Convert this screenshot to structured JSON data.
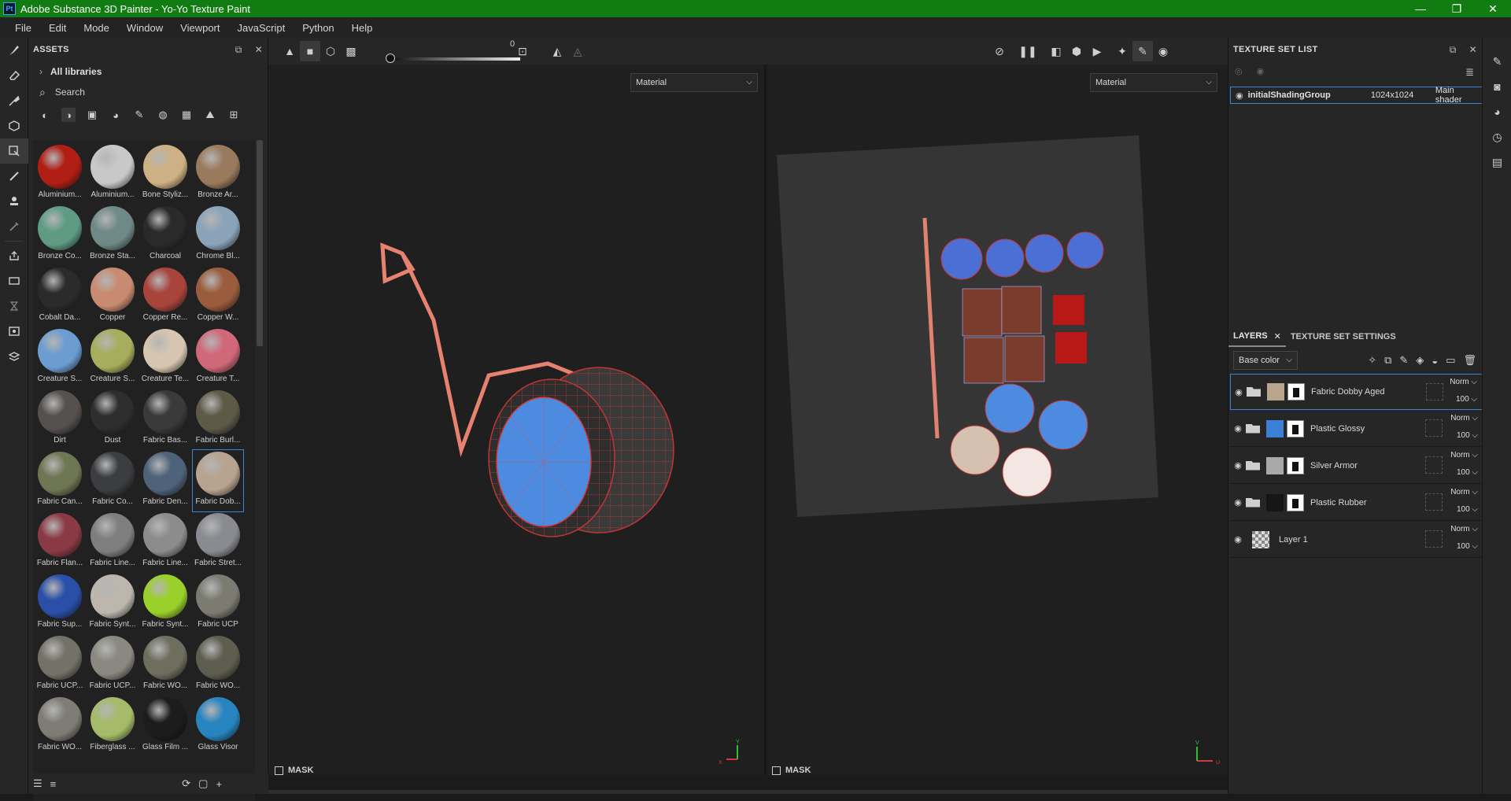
{
  "window": {
    "title": "Adobe Substance 3D Painter - Yo-Yo Texture Paint",
    "app_badge": "Pt",
    "minimize": "—",
    "maximize": "❐",
    "close": "✕"
  },
  "menu": [
    "File",
    "Edit",
    "Mode",
    "Window",
    "Viewport",
    "JavaScript",
    "Python",
    "Help"
  ],
  "assets": {
    "title": "ASSETS",
    "library": "All libraries",
    "search_placeholder": "Search",
    "materials": [
      {
        "label": "Aluminium...",
        "color": "#b01e14"
      },
      {
        "label": "Aluminium...",
        "color": "#c8c8c8"
      },
      {
        "label": "Bone Styliz...",
        "color": "#cdb083"
      },
      {
        "label": "Bronze Ar...",
        "color": "#9a7a5c"
      },
      {
        "label": "Bronze Co...",
        "color": "#5f9b84"
      },
      {
        "label": "Bronze Sta...",
        "color": "#6f8a86"
      },
      {
        "label": "Charcoal",
        "color": "#2a2a2a"
      },
      {
        "label": "Chrome Bl...",
        "color": "#8aa3b9"
      },
      {
        "label": "Cobalt Da...",
        "color": "#2b2b2b"
      },
      {
        "label": "Copper",
        "color": "#c88b71"
      },
      {
        "label": "Copper Re...",
        "color": "#a8443c"
      },
      {
        "label": "Copper W...",
        "color": "#9a5c3c"
      },
      {
        "label": "Creature S...",
        "color": "#6c9cd0"
      },
      {
        "label": "Creature S...",
        "color": "#a6ad5c"
      },
      {
        "label": "Creature Te...",
        "color": "#d6c5b0"
      },
      {
        "label": "Creature T...",
        "color": "#d0687a"
      },
      {
        "label": "Dirt",
        "color": "#54504e"
      },
      {
        "label": "Dust",
        "color": "#2e2e2e"
      },
      {
        "label": "Fabric Bas...",
        "color": "#3a3a3a"
      },
      {
        "label": "Fabric Burl...",
        "color": "#5e5a48"
      },
      {
        "label": "Fabric Can...",
        "color": "#6f7653"
      },
      {
        "label": "Fabric Co...",
        "color": "#3b3d41"
      },
      {
        "label": "Fabric Den...",
        "color": "#4e627a"
      },
      {
        "label": "Fabric Dob...",
        "color": "#b7a38f"
      },
      {
        "label": "Fabric Flan...",
        "color": "#8a3a44"
      },
      {
        "label": "Fabric Line...",
        "color": "#7e7e7e"
      },
      {
        "label": "Fabric Line...",
        "color": "#8c8c8c"
      },
      {
        "label": "Fabric Stret...",
        "color": "#898b90"
      },
      {
        "label": "Fabric Sup...",
        "color": "#2a4fa8"
      },
      {
        "label": "Fabric Synt...",
        "color": "#bcb6ad"
      },
      {
        "label": "Fabric Synt...",
        "color": "#9ad02a"
      },
      {
        "label": "Fabric UCP",
        "color": "#7b7b72"
      },
      {
        "label": "Fabric UCP...",
        "color": "#747268"
      },
      {
        "label": "Fabric UCP...",
        "color": "#8a8880"
      },
      {
        "label": "Fabric WO...",
        "color": "#6e6e5e"
      },
      {
        "label": "Fabric WO...",
        "color": "#5e5e50"
      },
      {
        "label": "Fabric WO...",
        "color": "#7e7c74"
      },
      {
        "label": "Fiberglass ...",
        "color": "#a5bb69"
      },
      {
        "label": "Glass Film ...",
        "color": "#1c1c1c"
      },
      {
        "label": "Glass Visor",
        "color": "#2784bf"
      }
    ]
  },
  "viewport": {
    "slider_value": "0",
    "left_dropdown": "Material",
    "right_dropdown": "Material",
    "mask_label_left": "MASK",
    "mask_label_right": "MASK",
    "axis_labels": {
      "y": "Y",
      "x": "X",
      "v": "V",
      "u": "U"
    }
  },
  "texture_set_list": {
    "title": "TEXTURE SET LIST",
    "row": {
      "name": "initialShadingGroup",
      "resolution": "1024x1024",
      "shader": "Main shader"
    }
  },
  "layers": {
    "tabs": [
      "LAYERS",
      "TEXTURE SET SETTINGS"
    ],
    "channel": "Base color",
    "items": [
      {
        "name": "Fabric Dobby Aged",
        "blend": "Norm",
        "opacity": "100",
        "thumb_color": "#b9a48e",
        "selected": true
      },
      {
        "name": "Plastic Glossy",
        "blend": "Norm",
        "opacity": "100",
        "thumb_color": "#3b7fd6",
        "selected": false
      },
      {
        "name": "Silver Armor",
        "blend": "Norm",
        "opacity": "100",
        "thumb_color": "#a9a9a9",
        "selected": false
      },
      {
        "name": "Plastic Rubber",
        "blend": "Norm",
        "opacity": "100",
        "thumb_color": "#161616",
        "selected": false
      },
      {
        "name": "Layer 1",
        "blend": "Norm",
        "opacity": "100",
        "thumb_color": "checker",
        "selected": false
      }
    ]
  },
  "colors": {
    "titlebar": "#117c11",
    "accent": "#3b82d8",
    "yoyo_face": "#4c8be0",
    "wire": "#d23a3a",
    "string": "#e07a70"
  }
}
